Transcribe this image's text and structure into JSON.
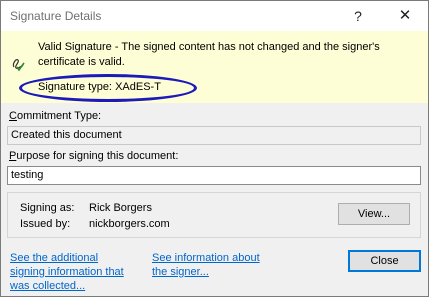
{
  "window": {
    "title": "Signature Details",
    "help_glyph": "?",
    "close_glyph": "✕"
  },
  "banner": {
    "message": "Valid Signature - The signed content has not changed and the signer's certificate is valid.",
    "signature_type_label": "Signature type:",
    "signature_type_value": "XAdES-T",
    "icon": "signature-valid-icon",
    "background": "#fefed6",
    "highlight_color": "#1c1ab8"
  },
  "commitment": {
    "label_prefix": "",
    "label_accel": "C",
    "label_rest": "ommitment Type:",
    "value": "Created this document"
  },
  "purpose": {
    "label_accel": "P",
    "label_rest": "urpose for signing this document:",
    "value": "testing"
  },
  "signer": {
    "signing_as_label": "Signing as:",
    "signing_as_value": "Rick Borgers",
    "issued_by_label": "Issued by:",
    "issued_by_value": "nickborgers.com",
    "view_button": "View..."
  },
  "links": {
    "additional_info_line1": "See the additional",
    "additional_info_line2": "signing information that",
    "additional_info_line3": "was collected...",
    "signer_info_line1": "See information about",
    "signer_info_line2": "the signer..."
  },
  "footer": {
    "close_button": "Close"
  },
  "colors": {
    "link": "#0066cc",
    "default_button_border": "#0078d7"
  }
}
